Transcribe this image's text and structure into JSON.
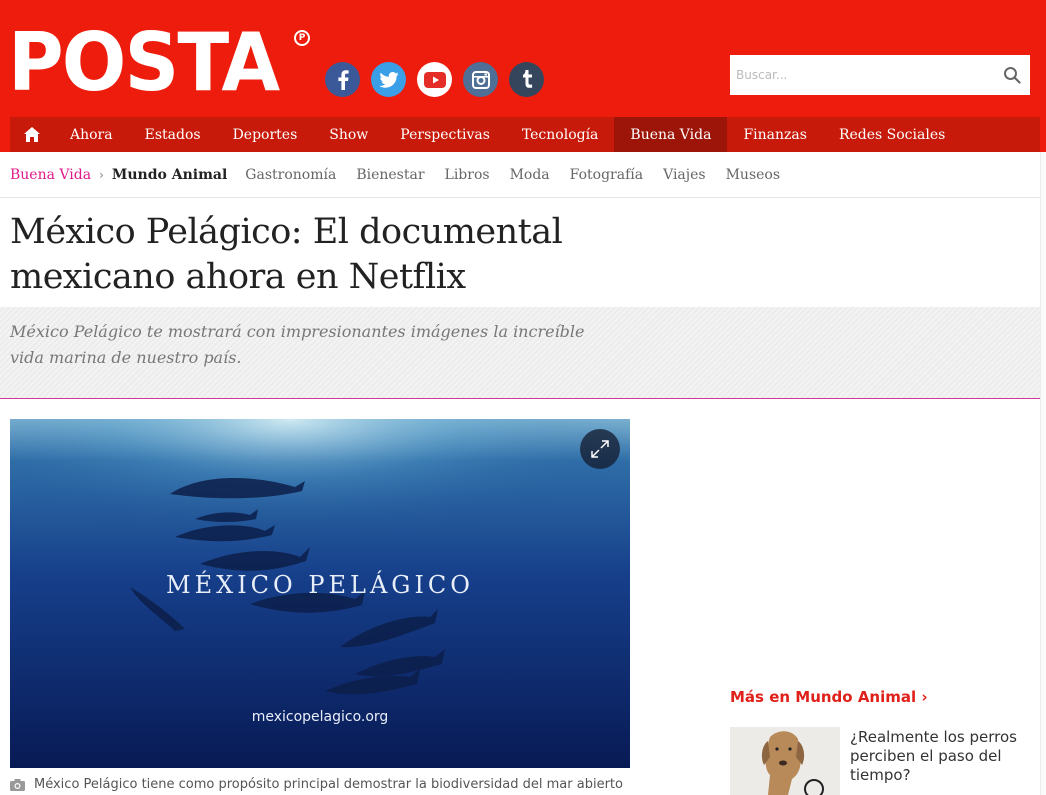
{
  "header": {
    "logo": "POSTA",
    "logo_mark": "P",
    "social": [
      "facebook-icon",
      "twitter-icon",
      "youtube-icon",
      "instagram-icon",
      "tumblr-icon"
    ],
    "search_placeholder": "Buscar..."
  },
  "nav": {
    "items": [
      "Ahora",
      "Estados",
      "Deportes",
      "Show",
      "Perspectivas",
      "Tecnología",
      "Buena Vida",
      "Finanzas",
      "Redes Sociales"
    ],
    "active": "Buena Vida"
  },
  "subnav": {
    "parent": "Buena Vida",
    "current": "Mundo Animal",
    "items": [
      "Gastronomía",
      "Bienestar",
      "Libros",
      "Moda",
      "Fotografía",
      "Viajes",
      "Museos"
    ]
  },
  "article": {
    "title": "México Pelágico: El documental mexicano ahora en Netflix",
    "summary": "México Pelágico te mostrará con impresionantes imágenes la increíble vida marina de nuestro país.",
    "image_title": "MÉXICO PELÁGICO",
    "image_url": "mexicopelagico.org",
    "caption": "México Pelágico tiene como propósito principal demostrar la biodiversidad del mar abierto"
  },
  "sidebar": {
    "more_heading": "Más en Mundo Animal",
    "related_title": "¿Realmente los perros perciben el paso del tiempo?"
  },
  "colors": {
    "brand_red": "#ee1c0c",
    "nav_red": "#c71a0a",
    "nav_active": "#9d1509",
    "pink_accent": "#e0198a"
  }
}
